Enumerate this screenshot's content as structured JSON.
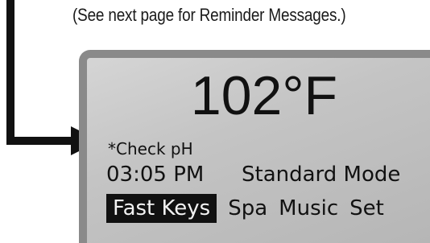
{
  "caption": {
    "text": "(See next page for Reminder Messages.)"
  },
  "display": {
    "temperature": "102°F",
    "reminder": "*Check pH",
    "time": "03:05 PM",
    "mode": "Standard Mode",
    "menu": [
      {
        "label": "Fast Keys",
        "selected": true
      },
      {
        "label": "Spa",
        "selected": false
      },
      {
        "label": "Music",
        "selected": false
      },
      {
        "label": "Set",
        "selected": false
      }
    ]
  }
}
